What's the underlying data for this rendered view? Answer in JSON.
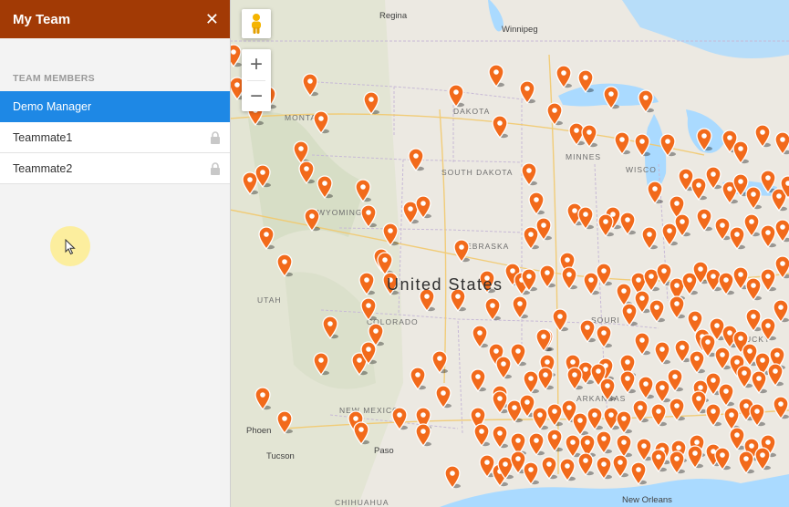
{
  "sidebar": {
    "title": "My Team",
    "close_symbol": "✕",
    "section_label": "TEAM MEMBERS",
    "members": [
      {
        "name": "Demo Manager",
        "active": true,
        "locked": false
      },
      {
        "name": "Teammate1",
        "active": false,
        "locked": true
      },
      {
        "name": "Teammate2",
        "active": false,
        "locked": true
      }
    ]
  },
  "map": {
    "country_label": "United States",
    "labels": {
      "regina": "Regina",
      "winnipeg": "Winnipeg",
      "montana": "MONTANA",
      "north_dakota": "DAKOTA",
      "minnesota": "MINNES",
      "south_dakota": "SOUTH DAKOTA",
      "wisconsin": "WISCO",
      "wyoming": "WYOMING",
      "nebraska": "NEBRASKA",
      "utah": "UTAH",
      "colorado": "COLORADO",
      "missouri": "SOURI",
      "kentucky": "UCKY",
      "arkansas": "ARKANSAS",
      "new_mexico": "NEW MEXICO",
      "phoenix": "Phoen",
      "tucson": "Tucson",
      "el_paso": "Paso",
      "chihuahua": "CHIHUAHUA",
      "new_orleans": "New Orleans"
    },
    "zoom_in_symbol": "+",
    "zoom_out_symbol": "−",
    "colors": {
      "marker": "#f26a1b",
      "water": "#aadaff",
      "land": "#ece9e2"
    }
  }
}
